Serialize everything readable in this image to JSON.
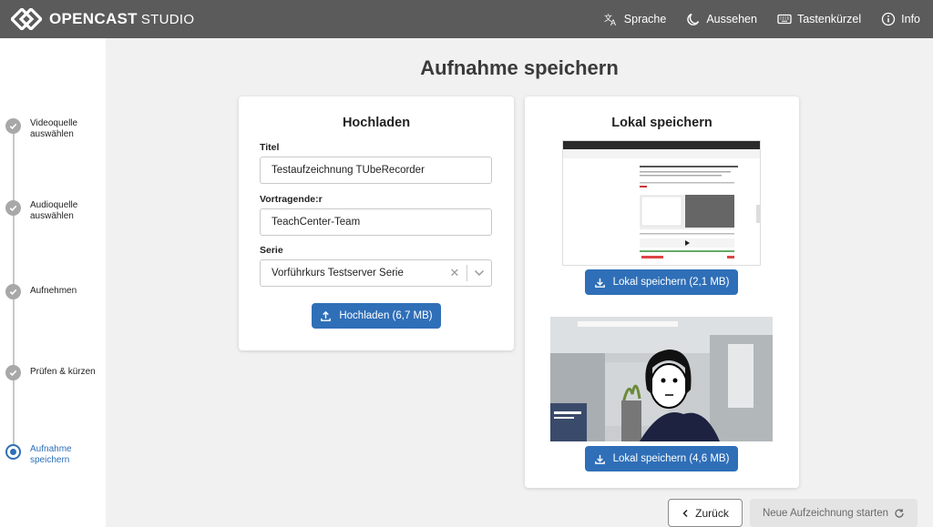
{
  "app": {
    "brand_bold": "OPENCAST",
    "brand_light": "STUDIO"
  },
  "nav": [
    {
      "label": "Sprache",
      "icon": "translate-icon"
    },
    {
      "label": "Aussehen",
      "icon": "moon-icon"
    },
    {
      "label": "Tastenkürzel",
      "icon": "keyboard-icon"
    },
    {
      "label": "Info",
      "icon": "info-icon"
    }
  ],
  "steps": [
    {
      "label": "Videoquelle auswählen",
      "state": "done"
    },
    {
      "label": "Audioquelle auswählen",
      "state": "done"
    },
    {
      "label": "Aufnehmen",
      "state": "done"
    },
    {
      "label": "Prüfen & kürzen",
      "state": "done"
    },
    {
      "label": "Aufnahme speichern",
      "state": "active"
    }
  ],
  "page_title": "Aufnahme speichern",
  "upload": {
    "title": "Hochladen",
    "title_label": "Titel",
    "title_value": "Testaufzeichnung TUbeRecorder",
    "presenter_label": "Vortragende:r",
    "presenter_value": "TeachCenter-Team",
    "series_label": "Serie",
    "series_value": "Vorführkurs Testserver Serie",
    "upload_button": "Hochladen (6,7 MB)"
  },
  "local": {
    "title": "Lokal speichern",
    "save_screen_button": "Lokal speichern (2,1 MB)",
    "save_camera_button": "Lokal speichern (4,6 MB)"
  },
  "footer": {
    "back_button": "Zurück",
    "new_recording_button": "Neue Aufzeichnung starten"
  },
  "colors": {
    "accent": "#2f6fb8",
    "topbar": "#5b5b5b"
  }
}
